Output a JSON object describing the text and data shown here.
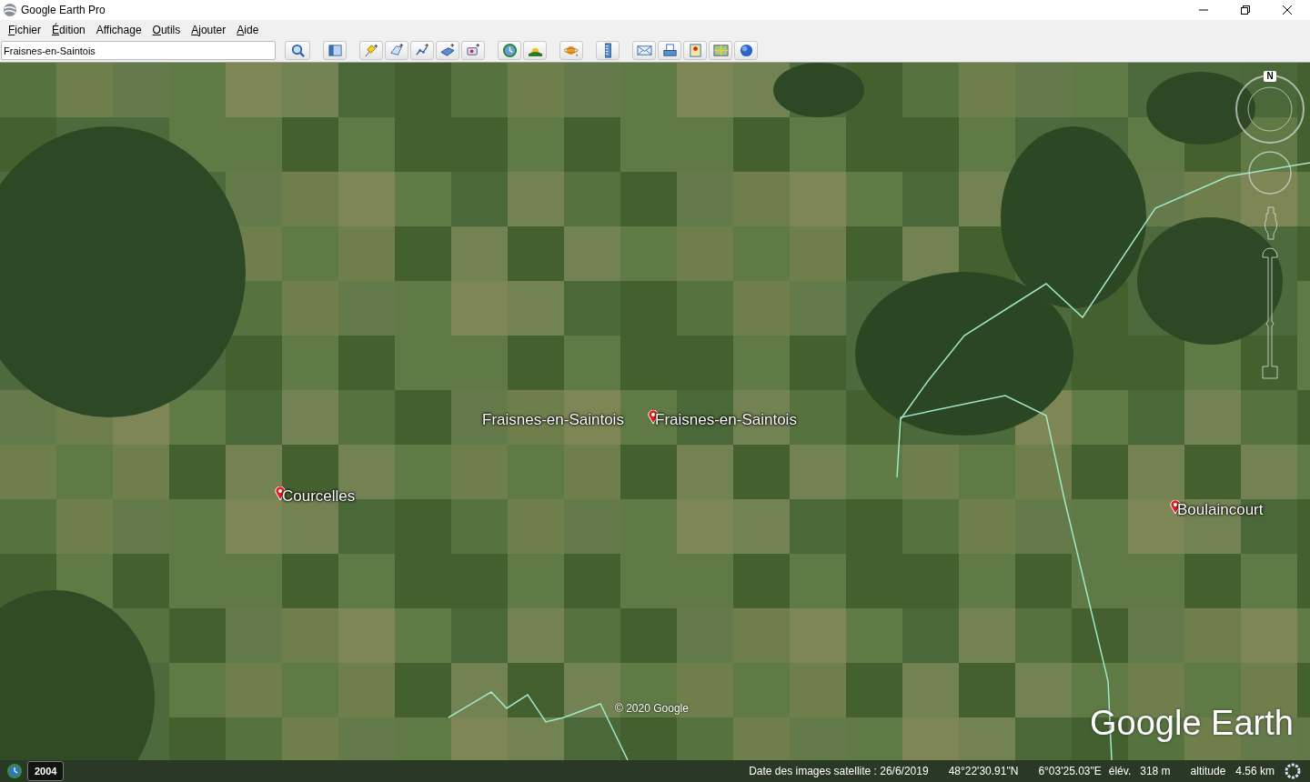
{
  "window": {
    "title": "Google Earth Pro"
  },
  "menu": [
    {
      "label": "Fichier",
      "mnemonic": true
    },
    {
      "label": "Édition",
      "mnemonic": true
    },
    {
      "label": "Affichage",
      "mnemonic": false
    },
    {
      "label": "Outils",
      "mnemonic": true
    },
    {
      "label": "Ajouter",
      "mnemonic": true
    },
    {
      "label": "Aide",
      "mnemonic": true
    }
  ],
  "search": {
    "value": "Fraisnes-en-Saintois"
  },
  "toolbar": [
    {
      "kind": "search"
    },
    {
      "kind": "sidebar"
    },
    {
      "kind": "placemark"
    },
    {
      "kind": "polygon"
    },
    {
      "kind": "path"
    },
    {
      "kind": "overlay"
    },
    {
      "kind": "tour"
    },
    {
      "kind": "history"
    },
    {
      "kind": "sun"
    },
    {
      "kind": "planet"
    },
    {
      "kind": "ruler"
    },
    {
      "kind": "email"
    },
    {
      "kind": "print"
    },
    {
      "kind": "save-image"
    },
    {
      "kind": "map"
    },
    {
      "kind": "globe"
    }
  ],
  "map": {
    "places": [
      {
        "label": "Fraisnes-en-Saintois",
        "pin": false
      },
      {
        "label": "Fraisnes-en-Saintois",
        "pin": true
      },
      {
        "label": "Courcelles",
        "pin": true
      },
      {
        "label": "Boulaincourt",
        "pin": true
      }
    ],
    "copyright": "© 2020 Google",
    "logo": "Google Earth",
    "compass_letter": "N"
  },
  "time_slider": {
    "year": "2004"
  },
  "status_bar": {
    "imagery_date": "Date des images satellite : 26/6/2019",
    "latitude": "48°22'30.91\"N",
    "longitude": "6°03'25.03\"E",
    "elevation_label": "élév.",
    "elevation": "318 m",
    "altitude_label": "altitude",
    "altitude": "4.56 km"
  }
}
